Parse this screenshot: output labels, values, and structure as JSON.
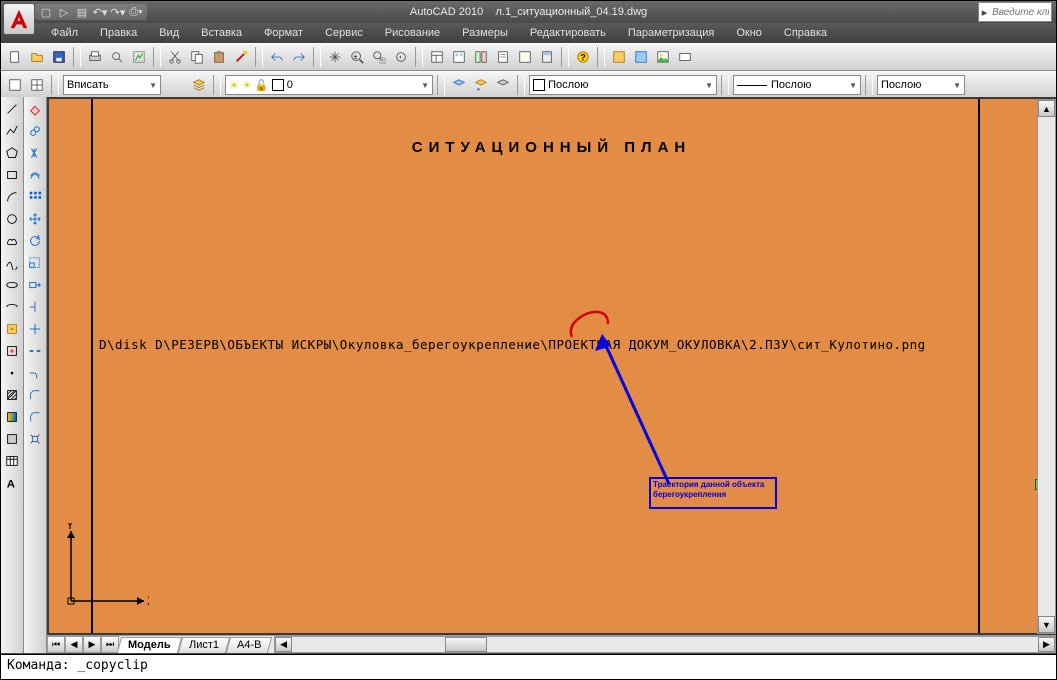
{
  "title": {
    "app": "AutoCAD 2010",
    "file": "л.1_ситуационный_04.19.dwg"
  },
  "search_placeholder": "Введите клю",
  "qat": [
    "new",
    "open",
    "save",
    "undo",
    "redo",
    "print"
  ],
  "menu": [
    "Файл",
    "Правка",
    "Вид",
    "Вставка",
    "Формат",
    "Сервис",
    "Рисование",
    "Размеры",
    "Редактировать",
    "Параметризация",
    "Окно",
    "Справка"
  ],
  "tb2": {
    "scale_label": "Вписать",
    "layer_value": "0",
    "lwt": "Послою",
    "color": "Послою",
    "plot": "Послою"
  },
  "canvas": {
    "heading": "СИТУАЦИОННЫЙ  ПЛАН",
    "path": "D\\disk D\\РЕЗЕРВ\\ОБЪЕКТЫ ИСКРЫ\\Окуловка_берегоукрепление\\ПРОЕКТНАЯ ДОКУМ_ОКУЛОВКА\\2.ПЗУ\\сит_Кулотино.png",
    "annotation_l1": "Траектория данной объекта",
    "annotation_l2": "берегоукрепления",
    "ucs_x": "X",
    "ucs_y": "Y"
  },
  "tabs": {
    "active": "Модель",
    "others": [
      "Лист1",
      "А4-В"
    ]
  },
  "command": "Команда: _copyclip"
}
